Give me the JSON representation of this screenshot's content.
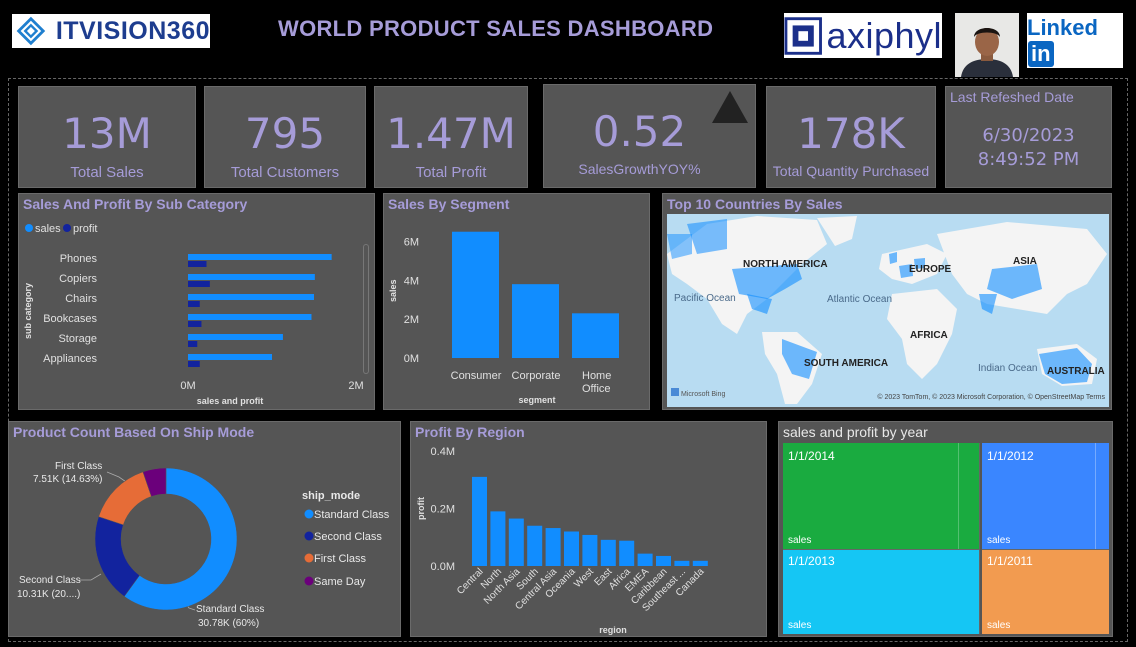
{
  "header": {
    "brand_left": "ITVISION360",
    "title": "WORLD PRODUCT SALES DASHBOARD",
    "brand_right": "axiphyl",
    "linkedin_text": "Linked",
    "linkedin_in": "in"
  },
  "kpis": {
    "total_sales": {
      "value": "13M",
      "label": "Total Sales"
    },
    "total_customers": {
      "value": "795",
      "label": "Total Customers"
    },
    "total_profit": {
      "value": "1.47M",
      "label": "Total Profit"
    },
    "sales_growth": {
      "value": "0.52",
      "label": "SalesGrowthYOY%"
    },
    "total_quantity": {
      "value": "178K",
      "label": "Total Quantity Purchased"
    },
    "last_refresh": {
      "label": "Last Refeshed Date",
      "date": "6/30/2023",
      "time": "8:49:52 PM"
    }
  },
  "colors": {
    "accent": "#a69cd8",
    "sales_blue": "#118dff",
    "profit_navy": "#12239e",
    "first_class": "#e66c37",
    "same_day": "#6b007b",
    "panel": "#555555",
    "treemap_2014": "#1aab40",
    "treemap_2012": "#3a86ff",
    "treemap_2013": "#15c6f4",
    "treemap_2011": "#f29b50"
  },
  "sub_category_panel": {
    "title": "Sales And Profit By Sub Category",
    "legend": [
      "sales",
      "profit"
    ],
    "ylabel": "sub category",
    "xlabel": "sales and profit",
    "xticks": [
      "0M",
      "2M"
    ]
  },
  "segment_panel": {
    "title": "Sales By Segment",
    "ylabel": "sales",
    "xlabel": "segment",
    "yticks": [
      "0M",
      "2M",
      "4M",
      "6M"
    ]
  },
  "map_panel": {
    "title": "Top 10 Countries By Sales",
    "labels": {
      "north_america": "NORTH AMERICA",
      "europe": "EUROPE",
      "asia": "ASIA",
      "pacific": "Pacific Ocean",
      "atlantic": "Atlantic Ocean",
      "africa": "AFRICA",
      "south_america": "SOUTH AMERICA",
      "indian": "Indian Ocean",
      "australia": "AUSTRALIA"
    },
    "bing": "Microsoft Bing",
    "copyright": "© 2023 TomTom, © 2023 Microsoft Corporation, © OpenStreetMap  Terms"
  },
  "ship_mode_panel": {
    "title": "Product Count Based On Ship Mode",
    "legend_title": "ship_mode",
    "legend": [
      "Standard Class",
      "Second Class",
      "First Class",
      "Same Day"
    ],
    "callouts": {
      "first_class": [
        "First Class",
        "7.51K (14.63%)"
      ],
      "second_class": [
        "Second Class",
        "10.31K (20....)"
      ],
      "standard_class": [
        "Standard Class",
        "30.78K (60%)"
      ]
    }
  },
  "region_panel": {
    "title": "Profit By Region",
    "ylabel": "profit",
    "xlabel": "region",
    "yticks": [
      "0.0M",
      "0.2M",
      "0.4M"
    ]
  },
  "year_panel": {
    "title": "sales and profit by year",
    "cells": [
      {
        "year": "1/1/2014",
        "sub": "sales"
      },
      {
        "year": "1/1/2012",
        "sub": "sales"
      },
      {
        "year": "1/1/2013",
        "sub": "sales"
      },
      {
        "year": "1/1/2011",
        "sub": "sales"
      }
    ]
  },
  "chart_data": [
    {
      "type": "bar",
      "orientation": "horizontal",
      "title": "Sales And Profit By Sub Category",
      "xlabel": "sales and profit",
      "ylabel": "sub category",
      "categories": [
        "Phones",
        "Copiers",
        "Chairs",
        "Bookcases",
        "Storage",
        "Appliances"
      ],
      "series": [
        {
          "name": "sales",
          "values": [
            1.71,
            1.51,
            1.5,
            1.47,
            1.13,
            1.0
          ]
        },
        {
          "name": "profit",
          "values": [
            0.22,
            0.26,
            0.14,
            0.16,
            0.11,
            0.14
          ]
        }
      ],
      "xlim": [
        0,
        2
      ]
    },
    {
      "type": "bar",
      "title": "Sales By Segment",
      "xlabel": "segment",
      "ylabel": "sales",
      "categories": [
        "Consumer",
        "Corporate",
        "Home Office"
      ],
      "values": [
        6.5,
        3.8,
        2.3
      ],
      "ylim": [
        0,
        7
      ]
    },
    {
      "type": "pie",
      "variant": "donut",
      "title": "Product Count Based On Ship Mode",
      "categories": [
        "Standard Class",
        "Second Class",
        "First Class",
        "Same Day"
      ],
      "values": [
        30.78,
        10.31,
        7.51,
        2.7
      ]
    },
    {
      "type": "bar",
      "title": "Profit By Region",
      "xlabel": "region",
      "ylabel": "profit",
      "categories": [
        "Central",
        "North",
        "North Asia",
        "South",
        "Central Asia",
        "Oceania",
        "West",
        "East",
        "Africa",
        "EMEA",
        "Caribbean",
        "Southeast ...",
        "Canada"
      ],
      "values": [
        0.31,
        0.19,
        0.165,
        0.14,
        0.132,
        0.12,
        0.108,
        0.091,
        0.088,
        0.043,
        0.035,
        0.018,
        0.018
      ],
      "ylim": [
        0,
        0.4
      ]
    }
  ]
}
